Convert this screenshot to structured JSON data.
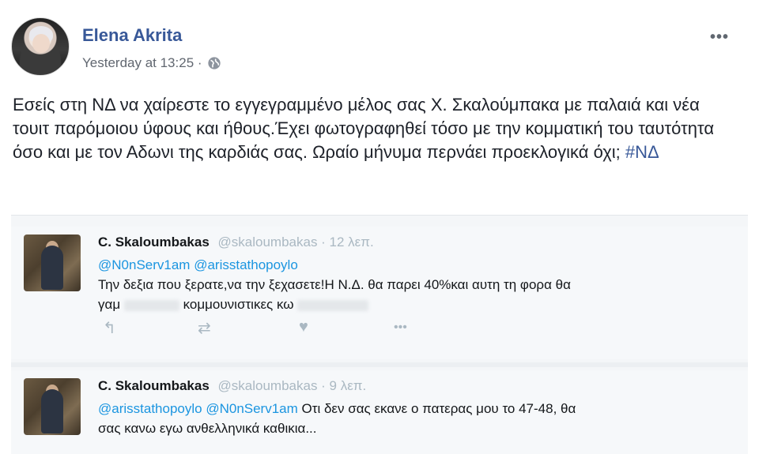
{
  "post": {
    "author": "Elena Akrita",
    "timestamp": "Yesterday at 13:25 ·",
    "privacy_icon": "globe-icon",
    "more_label": "•••",
    "text_main": "Εσείς στη ΝΔ να χαίρεστε το εγγεγραμμένο μέλος σας Χ. Σκαλούμπακα με παλαιά και νέα τουιτ παρόμοιου ύφους και ήθους.Έχει φωτογραφηθεί τόσο με την κομματική του ταυτότητα όσο και με τον Αδωνι της καρδιάς σας. Ωραίο μήνυμα περνάει προεκλογικά όχι;",
    "hashtag": "#ΝΔ"
  },
  "tweets": [
    {
      "name": "C. Skaloumbakas",
      "handle": "@skaloumbakas · 12 λεπ.",
      "mentions": "@N0nServ1am @arisstathopoylo",
      "line1": "Την δεξια που ξερατε,να την ξεχασετε!Η Ν.Δ. θα παρει 40%και αυτη τη φορα θα",
      "line2_a": "γαμ",
      "line2_b": "κομμουνιστικες κω"
    },
    {
      "name": "C. Skaloumbakas",
      "handle": "@skaloumbakas · 9 λεπ.",
      "mentions": "@arisstathopoylo @N0nServ1am",
      "line1": "Οτι δεν σας εκανε ο πατερας μου το 47-48, θα",
      "line2": "σας κανω εγω ανθελληνικά καθικια..."
    }
  ],
  "actions": {
    "reply_icon": "reply-icon",
    "retweet_icon": "retweet-icon",
    "like_icon": "heart-icon",
    "more_icon": "more-icon",
    "reply_glyph": "↰",
    "retweet_glyph": "⇄",
    "like_glyph": "♥",
    "more_glyph": "•••"
  }
}
